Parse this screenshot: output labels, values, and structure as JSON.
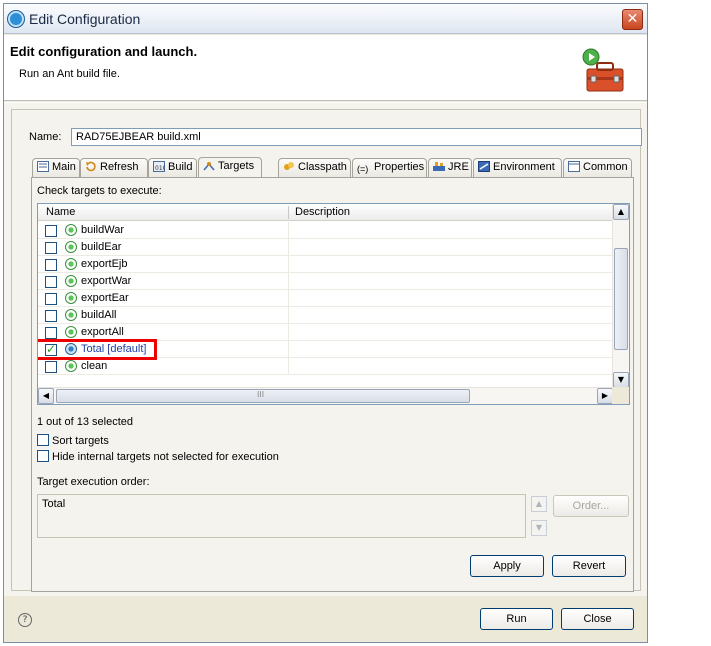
{
  "window": {
    "title": "Edit Configuration",
    "close_glyph": "✕"
  },
  "header": {
    "title": "Edit configuration and launch.",
    "subtitle": "Run an Ant build file."
  },
  "name": {
    "label": "Name:",
    "value": "RAD75EJBEAR build.xml"
  },
  "tabs": [
    {
      "label": "Main",
      "icon": "main-tab-icon"
    },
    {
      "label": "Refresh",
      "icon": "refresh-icon"
    },
    {
      "label": "Build",
      "icon": "build-icon"
    },
    {
      "label": "Targets",
      "icon": "targets-icon"
    },
    {
      "label": "Classpath",
      "icon": "classpath-icon"
    },
    {
      "label": "Properties",
      "icon": "properties-icon"
    },
    {
      "label": "JRE",
      "icon": "jre-icon"
    },
    {
      "label": "Environment",
      "icon": "environment-icon"
    },
    {
      "label": "Common",
      "icon": "common-icon"
    }
  ],
  "targets": {
    "check_label": "Check targets to execute:",
    "col_name": "Name",
    "col_description": "Description",
    "rows": [
      {
        "name": "buildWar",
        "checked": false
      },
      {
        "name": "buildEar",
        "checked": false
      },
      {
        "name": "exportEjb",
        "checked": false
      },
      {
        "name": "exportWar",
        "checked": false
      },
      {
        "name": "exportEar",
        "checked": false
      },
      {
        "name": "buildAll",
        "checked": false
      },
      {
        "name": "exportAll",
        "checked": false
      },
      {
        "name": "Total [default]",
        "checked": true
      },
      {
        "name": "clean",
        "checked": false
      }
    ],
    "scroll_grip": "III",
    "selected_count": "1 out of 13 selected",
    "sort_label": "Sort targets",
    "hide_label": "Hide internal targets not selected for execution",
    "order_label": "Target execution order:",
    "order_value": "Total",
    "order_button": "Order..."
  },
  "buttons": {
    "apply": "Apply",
    "revert": "Revert",
    "run": "Run",
    "close": "Close"
  },
  "help_glyph": "?",
  "colors": {
    "highlight": "#e00000",
    "accent": "#003c74"
  }
}
